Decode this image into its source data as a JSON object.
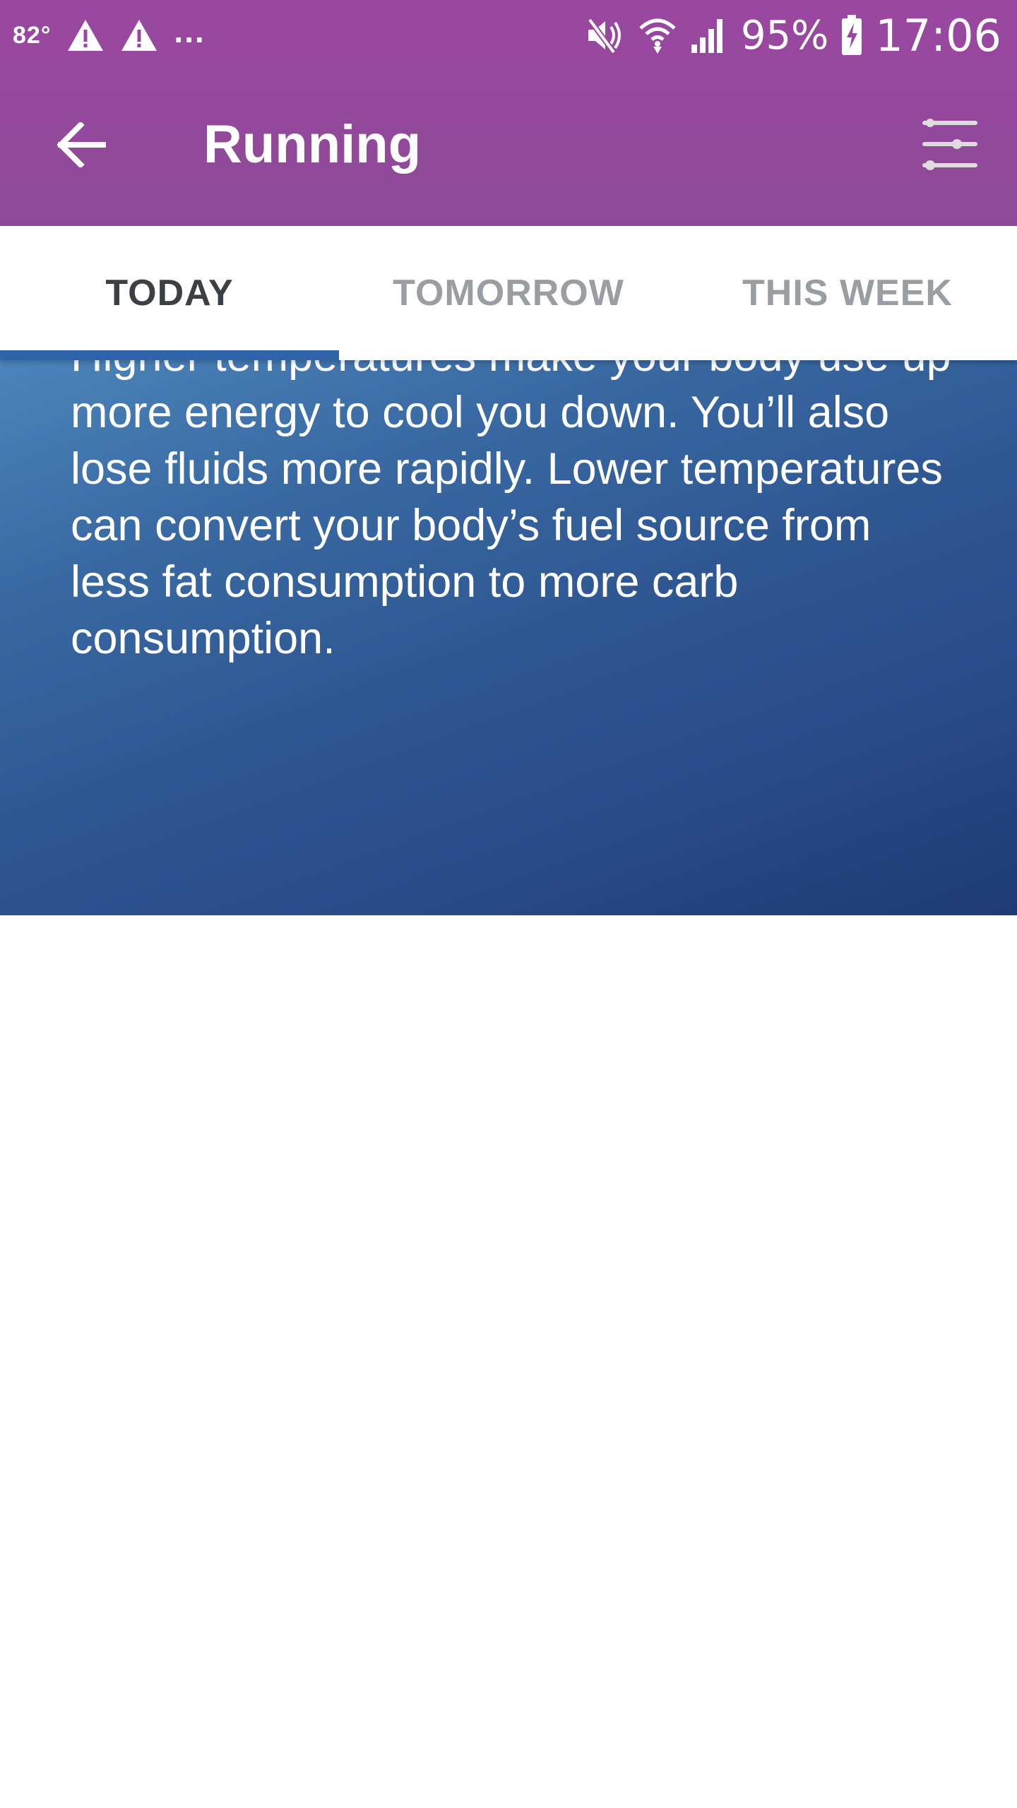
{
  "status_bar": {
    "temperature": "82°",
    "overflow": "...",
    "battery": "95%",
    "time": "17:06",
    "icons": [
      "warning-icon",
      "warning-icon",
      "mute-icon",
      "wifi-icon",
      "signal-icon",
      "battery-charging-icon"
    ]
  },
  "toolbar": {
    "title": "Running",
    "back_icon": "arrow-back-icon",
    "filter_icon": "tune-icon"
  },
  "tabs": [
    {
      "label": "TODAY",
      "active": true
    },
    {
      "label": "TOMORROW",
      "active": false
    },
    {
      "label": "THIS WEEK",
      "active": false
    }
  ],
  "card": {
    "text": "Higher temperatures make your body use up more energy to cool you down. You’ll also lose fluids more rapidly. Lower temperatures can convert your body’s fuel source from less fat consumption to more carb consumption."
  },
  "colors": {
    "appbar": "#9a47a0",
    "tab_indicator": "#2f65a8",
    "card_gradient_start": "#4c86bb",
    "card_gradient_end": "#1f3a74"
  }
}
